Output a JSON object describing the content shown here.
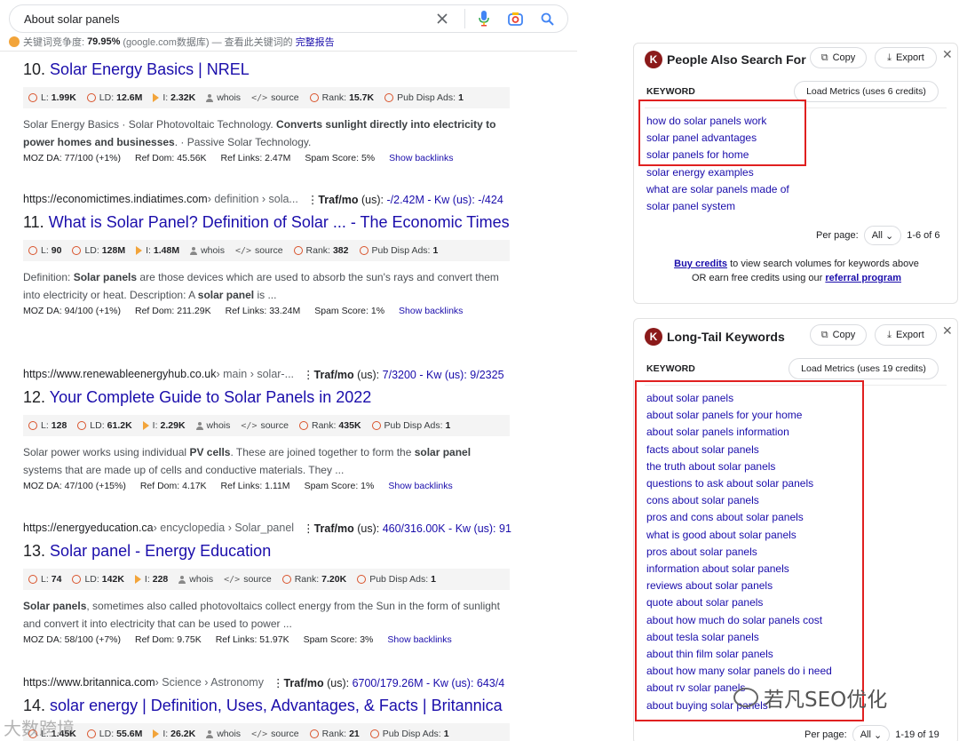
{
  "search": {
    "query": "About solar panels",
    "kw_prefix": "关键词竞争度:",
    "kw_value": "79.95%",
    "kw_suffix": "(google.com数据库) — 查看此关键词的",
    "kw_link": "完整报告"
  },
  "results": [
    {
      "url": "",
      "crumbs": "",
      "traf": "",
      "number": "10.",
      "title": "Solar Energy Basics | NREL",
      "metrics": {
        "L": "1.99K",
        "LD": "12.6M",
        "I": "2.32K",
        "rank": "15.7K",
        "ads": "1"
      },
      "snippet_html": "Solar Energy Basics · Solar Photovoltaic Technology. <b>Converts sunlight directly into electricity to power homes and businesses</b>. · Passive Solar Technology.",
      "moz": {
        "da": "MOZ DA: 77/100 (+1%)",
        "refdom": "Ref Dom: 45.56K",
        "reflinks": "Ref Links: 2.47M",
        "spam": "Spam Score: 5%"
      }
    },
    {
      "url": "https://economictimes.indiatimes.com",
      "crumbs": " › definition › sola...",
      "traf": "-/2.42M - Kw (us): -/424",
      "number": "11.",
      "title": "What is Solar Panel? Definition of Solar ... - The Economic Times",
      "metrics": {
        "L": "90",
        "LD": "128M",
        "I": "1.48M",
        "rank": "382",
        "ads": "1"
      },
      "snippet_html": "Definition: <b>Solar panels</b> are those devices which are used to absorb the sun's rays and convert them into electricity or heat. Description: A <b>solar panel</b> is ...",
      "moz": {
        "da": "MOZ DA: 94/100 (+1%)",
        "refdom": "Ref Dom: 211.29K",
        "reflinks": "Ref Links: 33.24M",
        "spam": "Spam Score: 1%"
      }
    },
    {
      "url": "https://www.renewableenergyhub.co.uk",
      "crumbs": " › main › solar-...",
      "traf": "7/3200 - Kw (us): 9/2325",
      "number": "12.",
      "title": "Your Complete Guide to Solar Panels in 2022",
      "metrics": {
        "L": "128",
        "LD": "61.2K",
        "I": "2.29K",
        "rank": "435K",
        "ads": "1"
      },
      "snippet_html": "Solar power works using individual <b>PV cells</b>. These are joined together to form the <b>solar panel</b> systems that are made up of cells and conductive materials. They ...",
      "moz": {
        "da": "MOZ DA: 47/100 (+15%)",
        "refdom": "Ref Dom: 4.17K",
        "reflinks": "Ref Links: 1.11M",
        "spam": "Spam Score: 1%"
      }
    },
    {
      "url": "https://energyeducation.ca",
      "crumbs": " › encyclopedia › Solar_panel",
      "traf": "460/316.00K - Kw (us): 91",
      "number": "13.",
      "title": "Solar panel - Energy Education",
      "metrics": {
        "L": "74",
        "LD": "142K",
        "I": "228",
        "rank": "7.20K",
        "ads": "1"
      },
      "snippet_html": "<b>Solar panels</b>, sometimes also called photovoltaics collect energy from the Sun in the form of sunlight and convert it into electricity that can be used to power ...",
      "moz": {
        "da": "MOZ DA: 58/100 (+7%)",
        "refdom": "Ref Dom: 9.75K",
        "reflinks": "Ref Links: 51.97K",
        "spam": "Spam Score: 3%"
      }
    },
    {
      "url": "https://www.britannica.com",
      "crumbs": " › Science › Astronomy",
      "traf": "6700/179.26M - Kw (us): 643/4",
      "number": "14.",
      "title": "solar energy | Definition, Uses, Advantages, & Facts | Britannica",
      "metrics": {
        "L": "1.45K",
        "LD": "55.6M",
        "I": "26.2K",
        "rank": "21",
        "ads": "1"
      },
      "snippet_html": "",
      "moz": {
        "da": "",
        "refdom": "",
        "reflinks": "",
        "spam": ""
      }
    }
  ],
  "labels": {
    "L": "L:",
    "LD": "LD:",
    "I": "I:",
    "whois": "whois",
    "source": "source",
    "rank": "Rank:",
    "ads": "Pub Disp Ads:",
    "traf": "Traf/mo",
    "us": "(us):",
    "show_backlinks": "Show backlinks"
  },
  "panel1": {
    "title": "People Also Search For",
    "copy": "Copy",
    "export": "Export",
    "keyword_header": "KEYWORD",
    "load": "Load Metrics (uses 6 credits)",
    "keywords": [
      "how do solar panels work",
      "solar panel advantages",
      "solar panels for home",
      "solar energy examples",
      "what are solar panels made of",
      "solar panel system"
    ],
    "per_page_label": "Per page:",
    "per_page_value": "All",
    "range": "1-6 of 6",
    "credits_link": "Buy credits",
    "credits_text": "to view search volumes for keywords above",
    "credits_line2": "OR earn free credits using our",
    "referral": "referral program"
  },
  "panel2": {
    "title": "Long-Tail Keywords",
    "copy": "Copy",
    "export": "Export",
    "keyword_header": "KEYWORD",
    "load": "Load Metrics (uses 19 credits)",
    "keywords": [
      "about solar panels",
      "about solar panels for your home",
      "about solar panels information",
      "facts about solar panels",
      "the truth about solar panels",
      "questions to ask about solar panels",
      "cons about solar panels",
      "pros and cons about solar panels",
      "what is good about solar panels",
      "pros about solar panels",
      "information about solar panels",
      "reviews about solar panels",
      "quote about solar panels",
      "about how much do solar panels cost",
      "about tesla solar panels",
      "about thin film solar panels",
      "about how many solar panels do i need",
      "about rv solar panels",
      "about buying solar panels"
    ],
    "per_page_label": "Per page:",
    "per_page_value": "All",
    "range": "1-19 of 19"
  },
  "watermark": {
    "right": "若凡SEO优化",
    "left": "大数跨境"
  }
}
